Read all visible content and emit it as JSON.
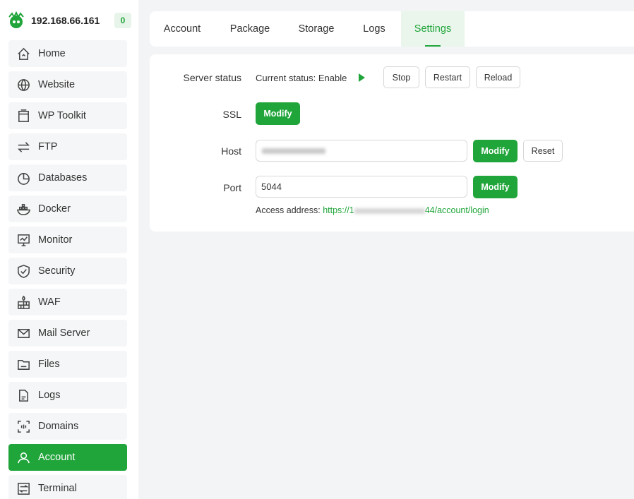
{
  "server": {
    "ip": "192.168.66.161",
    "count": "0"
  },
  "sidebar": {
    "items": [
      {
        "label": "Home",
        "icon": "home-icon"
      },
      {
        "label": "Website",
        "icon": "globe-icon"
      },
      {
        "label": "WP Toolkit",
        "icon": "wp-toolkit-icon"
      },
      {
        "label": "FTP",
        "icon": "transfer-icon"
      },
      {
        "label": "Databases",
        "icon": "database-icon"
      },
      {
        "label": "Docker",
        "icon": "docker-icon"
      },
      {
        "label": "Monitor",
        "icon": "monitor-icon"
      },
      {
        "label": "Security",
        "icon": "shield-icon"
      },
      {
        "label": "WAF",
        "icon": "firewall-icon"
      },
      {
        "label": "Mail Server",
        "icon": "mail-icon"
      },
      {
        "label": "Files",
        "icon": "folder-icon"
      },
      {
        "label": "Logs",
        "icon": "log-file-icon"
      },
      {
        "label": "Domains",
        "icon": "domains-icon"
      },
      {
        "label": "Account",
        "icon": "user-icon",
        "active": true
      },
      {
        "label": "Terminal",
        "icon": "terminal-icon"
      }
    ]
  },
  "tabs": [
    {
      "label": "Account"
    },
    {
      "label": "Package"
    },
    {
      "label": "Storage"
    },
    {
      "label": "Logs"
    },
    {
      "label": "Settings",
      "active": true
    }
  ],
  "settings": {
    "server_status_label": "Server status",
    "current_status": "Current status: Enable",
    "stop_label": "Stop",
    "restart_label": "Restart",
    "reload_label": "Reload",
    "ssl_label": "SSL",
    "ssl_modify": "Modify",
    "host_label": "Host",
    "host_modify": "Modify",
    "host_reset": "Reset",
    "port_label": "Port",
    "port_value": "5044",
    "port_modify": "Modify",
    "access_prefix": "Access address:",
    "access_link_start": "https://1",
    "access_link_end": "44/account/login"
  },
  "colors": {
    "accent": "#20a53a",
    "accent_light": "#eaf6ec"
  }
}
